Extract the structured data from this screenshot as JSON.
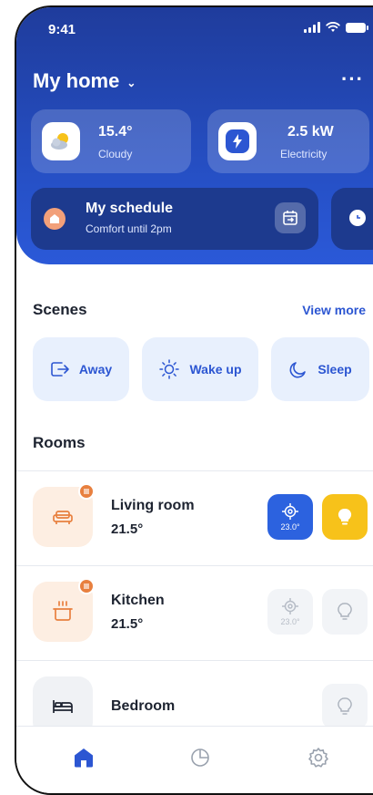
{
  "status": {
    "time": "9:41"
  },
  "header": {
    "title": "My home"
  },
  "stats": [
    {
      "value": "15.4°",
      "label": "Cloudy",
      "icon": "weather-cloudy-icon"
    },
    {
      "value": "2.5 kW",
      "label": "Electricity",
      "icon": "lightning-icon"
    }
  ],
  "schedule": {
    "title": "My schedule",
    "subtitle": "Comfort until 2pm"
  },
  "scenes": {
    "title": "Scenes",
    "view_more": "View more",
    "items": [
      {
        "label": "Away",
        "icon": "exit-icon"
      },
      {
        "label": "Wake up",
        "icon": "sun-icon"
      },
      {
        "label": "Sleep",
        "icon": "moon-icon"
      }
    ]
  },
  "rooms": {
    "title": "Rooms",
    "items": [
      {
        "name": "Living room",
        "temp": "21.5°",
        "thermostat": "23.0°",
        "active": true
      },
      {
        "name": "Kitchen",
        "temp": "21.5°",
        "thermostat": "23.0°",
        "active": false
      },
      {
        "name": "Bedroom",
        "temp": "",
        "active": false
      }
    ]
  },
  "colors": {
    "primary": "#2c56d2",
    "accent_yellow": "#f7c21a",
    "accent_orange": "#e8803f"
  }
}
